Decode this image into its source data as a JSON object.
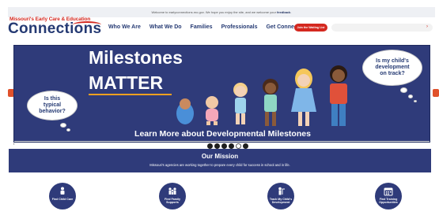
{
  "notice": {
    "text": "Welcome to earlyconnections.mo.gov. We hope you enjoy the site, and we welcome your",
    "link": "feedback",
    "suffix": "."
  },
  "logo": {
    "top_line": "Missouri's Early Care & Education",
    "main": "Connections"
  },
  "nav": {
    "items": [
      "Who We Are",
      "What We Do",
      "Families",
      "Professionals",
      "Get Connected"
    ]
  },
  "waitlist_button": "Join the Waiting List",
  "hero": {
    "title_line1": "Milestones",
    "title_line2": "MATTER",
    "bubble_left": "Is this typical behavior?",
    "bubble_right": "Is my child's development on track?",
    "cta": "Learn More about Developmental Milestones"
  },
  "mission": {
    "title": "Our Mission",
    "text": "Missouri's agencies are working together to prepare every child for success in school and in life."
  },
  "quick_links": [
    {
      "label": "Find Child Care",
      "icon": "child-icon"
    },
    {
      "label": "Find Family Supports",
      "icon": "family-icon"
    },
    {
      "label": "Track My Child's Development",
      "icon": "growth-icon"
    },
    {
      "label": "Find Training Opportunities",
      "icon": "calendar-icon"
    }
  ],
  "colors": {
    "brand_navy": "#253a73",
    "brand_red": "#d4281f",
    "hero_bg": "#2f3b7a"
  }
}
